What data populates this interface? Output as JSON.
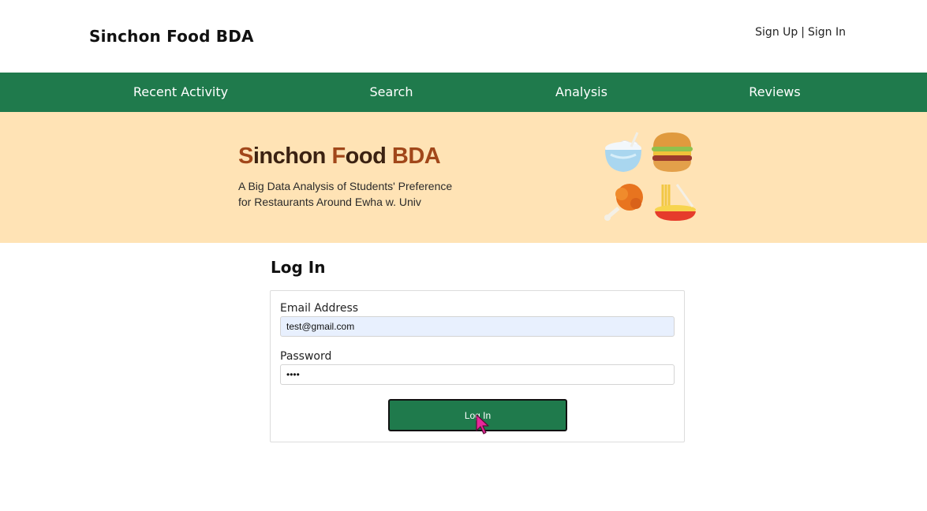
{
  "header": {
    "site_title": "Sinchon Food BDA",
    "sign_up": "Sign Up",
    "separator": "|",
    "sign_in": "Sign In"
  },
  "nav": {
    "items": [
      {
        "label": "Recent Activity"
      },
      {
        "label": "Search"
      },
      {
        "label": "Analysis"
      },
      {
        "label": "Reviews"
      }
    ]
  },
  "banner": {
    "title_s": "S",
    "title_rest1": "inchon ",
    "title_f": "F",
    "title_rest2": "ood ",
    "title_bda": "BDA",
    "subtitle_line1": "A Big Data Analysis of Students' Preference",
    "subtitle_line2": "for Restaurants Around Ewha w. Univ",
    "icons": [
      "rice-bowl-icon",
      "burger-icon",
      "fried-chicken-icon",
      "noodles-icon"
    ]
  },
  "login": {
    "title": "Log In",
    "email_label": "Email Address",
    "email_value": "test@gmail.com",
    "password_label": "Password",
    "password_value": "••••",
    "button_label": "Log In"
  },
  "colors": {
    "nav_bg": "#1f7a4c",
    "banner_bg": "#ffe3b5",
    "button_bg": "#1f7a4c",
    "email_autofill_bg": "#e8f0fe"
  }
}
